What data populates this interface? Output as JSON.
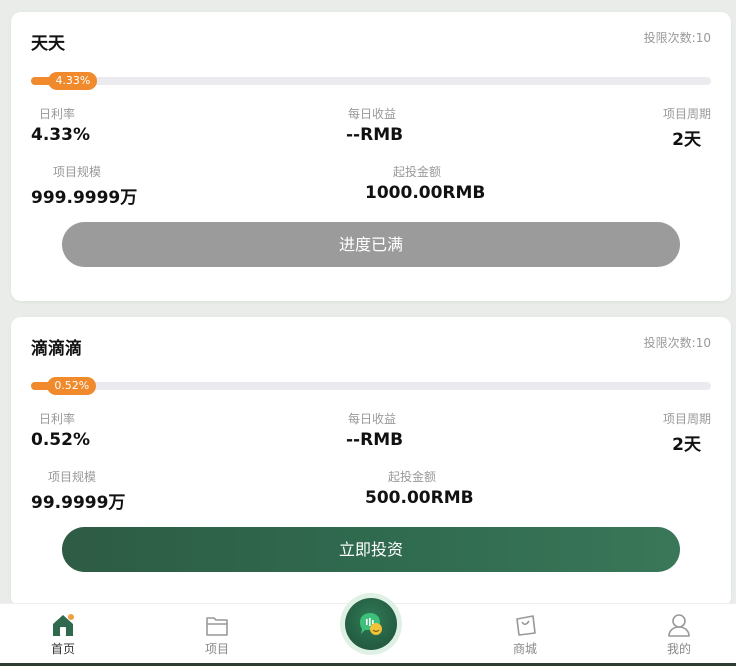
{
  "projects": [
    {
      "title": "天天",
      "invest_count": "投限次数:10",
      "progress_percent": 4.33,
      "progress_label": "4.33%",
      "daily_rate_label": "日利率",
      "daily_rate_value": "4.33%",
      "daily_income_label": "每日收益",
      "daily_income_value": "--RMB",
      "period_label": "项目周期",
      "period_value": "2天",
      "scale_label": "项目规模",
      "scale_value": "999.9999万",
      "min_invest_label": "起投金额",
      "min_invest_value": "1000.00RMB",
      "button_label": "进度已满",
      "button_state": "disabled"
    },
    {
      "title": "滴滴滴",
      "invest_count": "投限次数:10",
      "progress_percent": 0.52,
      "progress_label": "0.52%",
      "daily_rate_label": "日利率",
      "daily_rate_value": "0.52%",
      "daily_income_label": "每日收益",
      "daily_income_value": "--RMB",
      "period_label": "项目周期",
      "period_value": "2天",
      "scale_label": "项目规模",
      "scale_value": "99.9999万",
      "min_invest_label": "起投金额",
      "min_invest_value": "500.00RMB",
      "button_label": "立即投资",
      "button_state": "enabled"
    }
  ],
  "tabbar": {
    "items": [
      {
        "label": "首页",
        "icon": "home-icon",
        "active": true
      },
      {
        "label": "项目",
        "icon": "folder-icon",
        "active": false
      },
      {
        "label": "",
        "icon": "chat-center-icon",
        "active": false
      },
      {
        "label": "商城",
        "icon": "shopping-bag-icon",
        "active": false
      },
      {
        "label": "我的",
        "icon": "user-icon",
        "active": false
      }
    ]
  },
  "colors": {
    "accent_orange": "#f08a2c",
    "brand_green": "#2f6a4f",
    "disabled_gray": "#9b9b9b",
    "background": "#e9ece8"
  }
}
